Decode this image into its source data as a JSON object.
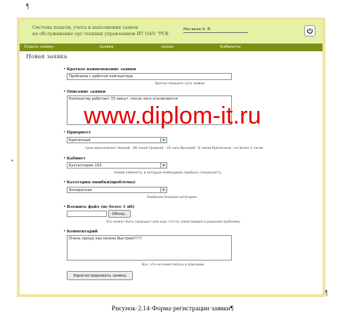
{
  "document": {
    "pilcrow": "¶",
    "caption": "Рисунок·2.14·Форма·регистрации·заявки¶"
  },
  "header": {
    "system_title_line1": "Система подачи, учета и выполнения заявок",
    "system_title_line2": "на обслуживание орг.техники управлением ИТ ОАО \"РСК",
    "user_name": "Матвеев А. В."
  },
  "menu": {
    "items": [
      "Подать заявку",
      "Заявки",
      "Архив",
      "Кабинеты"
    ]
  },
  "page": {
    "title": "Новая заявка"
  },
  "form": {
    "short_name": {
      "label": "Краткое наименование заявки",
      "value": "Проблема с работой компьютера",
      "hint": "Кратко опишите суть заявки"
    },
    "description": {
      "label": "Описание заявки",
      "value": "Компьютер работает 15 минут, после чего отключается"
    },
    "priority": {
      "label": "Приоритет",
      "value": "Критичный",
      "hint": "Срок выполнения: Низкий - 48 часов Средний - 24 часа Высокий - 8 часов Критичный - не более 2 часов"
    },
    "cabinet": {
      "label": "Кабинет",
      "value": "Бухгалтерия 103",
      "hint": "Номер кабинета, в который необходимо прибыть специалисту"
    },
    "category": {
      "label": "Категория ошибки(проблемы)",
      "value": "Аппаратная",
      "hint": "Наиболее близкая категория"
    },
    "attach": {
      "label": "Вложить файл (не более 1 мб)",
      "browse_label": "Обзор..",
      "hint": "Это может быть скриншот или еще что-то, помогающее в решении проблемы"
    },
    "comment": {
      "label": "Комментарий",
      "value": "Очень прошу как можно быстрее!!!!!!",
      "hint": "Все, что не поместилось в описании"
    },
    "submit_label": "Зарегистрировать заявку"
  },
  "watermark": "www.diplom-it.ru",
  "colors": {
    "header_bg": "#e4f2a6",
    "menu_bg": "#7c8f18",
    "frame_border": "#efe3a0",
    "watermark": "#e60000"
  }
}
